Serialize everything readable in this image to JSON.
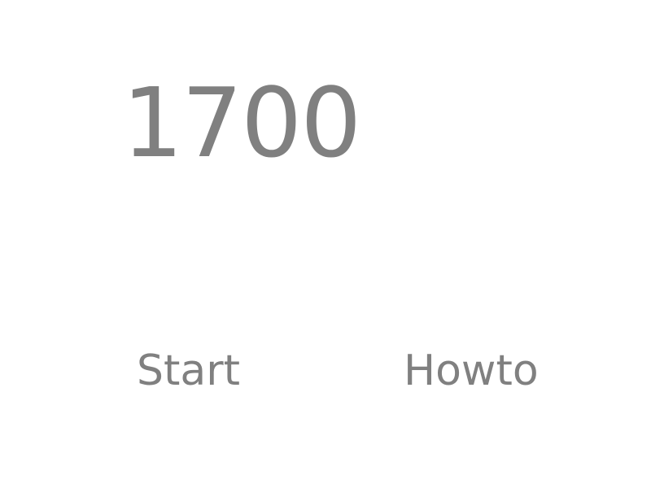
{
  "score": {
    "value": "1700"
  },
  "menu": {
    "start_label": "Start",
    "howto_label": "Howto"
  },
  "colors": {
    "background": "#ffffff",
    "text": "#808080"
  }
}
